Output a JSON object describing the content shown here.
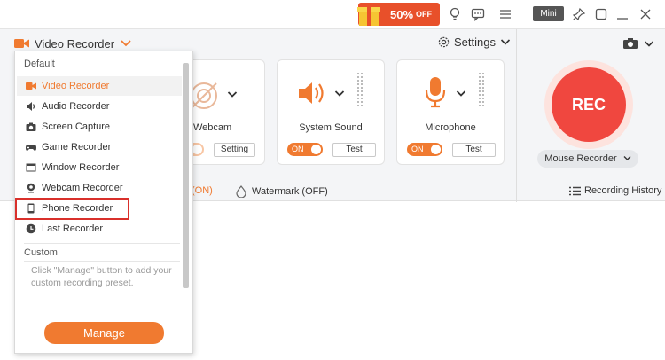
{
  "topbar": {
    "promo": {
      "discount": "50%",
      "suffix": "OFF"
    },
    "mini_label": "Mini",
    "icons": [
      "bulb-icon",
      "chat-icon",
      "menu-icon",
      "pin-icon",
      "restore-icon",
      "close-icon"
    ]
  },
  "header": {
    "title": "Video Recorder",
    "settings_label": "Settings"
  },
  "cards": {
    "webcam": {
      "label": "Webcam",
      "setting_label": "Setting"
    },
    "system_sound": {
      "label": "System Sound",
      "toggle": "ON",
      "test_label": "Test"
    },
    "microphone": {
      "label": "Microphone",
      "toggle": "ON",
      "test_label": "Test"
    }
  },
  "rec": {
    "label": "REC",
    "mode_label": "Mouse Recorder"
  },
  "footer": {
    "auto_stop_suffix": "(ON)",
    "watermark_label": "Watermark (OFF)",
    "history_label": "Recording History"
  },
  "dropdown": {
    "default_header": "Default",
    "items": [
      {
        "label": "Video Recorder",
        "icon": "video-camera-icon"
      },
      {
        "label": "Audio Recorder",
        "icon": "speaker-icon"
      },
      {
        "label": "Screen Capture",
        "icon": "camera-icon"
      },
      {
        "label": "Game Recorder",
        "icon": "gamepad-icon"
      },
      {
        "label": "Window Recorder",
        "icon": "window-icon"
      },
      {
        "label": "Webcam Recorder",
        "icon": "webcam-icon"
      },
      {
        "label": "Phone Recorder",
        "icon": "phone-icon"
      },
      {
        "label": "Last Recorder",
        "icon": "clock-icon"
      }
    ],
    "custom_header": "Custom",
    "custom_hint": "Click \"Manage\" button to add your custom recording preset.",
    "manage_label": "Manage"
  },
  "colors": {
    "accent": "#f07a30",
    "rec": "#f0473f",
    "highlight": "#d9302b"
  }
}
